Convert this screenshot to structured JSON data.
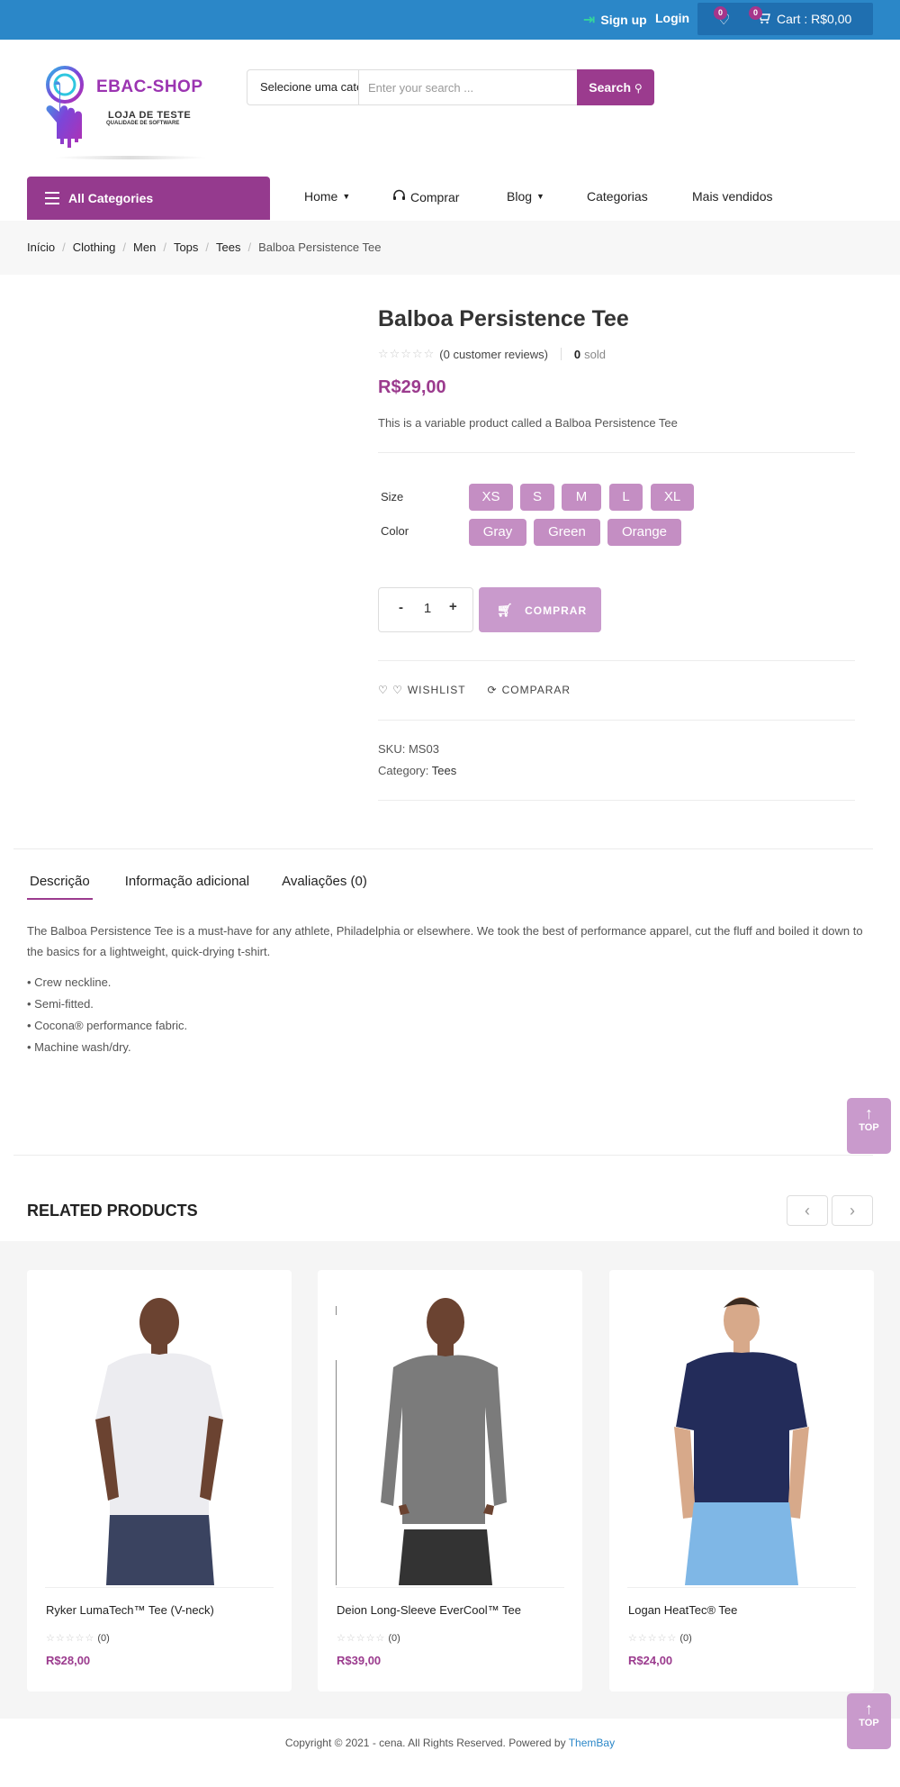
{
  "topbar": {
    "signup": "Sign up",
    "login": "Login",
    "wishlist_count": "0",
    "cart_count": "0",
    "cart_label": "Cart : R$0,00"
  },
  "header": {
    "brand": "EBAC-SHOP",
    "tagline": "LOJA DE TESTE",
    "tagline_sub": "QUALIDADE DE SOFTWARE",
    "category_select": "Selecione uma categoria",
    "search_placeholder": "Enter your search ...",
    "search_button": "Search"
  },
  "nav": {
    "all_categories": "All Categories",
    "home": "Home",
    "comprar": "Comprar",
    "blog": "Blog",
    "categorias": "Categorias",
    "mais_vendidos": "Mais vendidos"
  },
  "breadcrumb": [
    "Início",
    "Clothing",
    "Men",
    "Tops",
    "Tees",
    "Balboa Persistence Tee"
  ],
  "product": {
    "title": "Balboa Persistence Tee",
    "stars": "☆☆☆☆☆",
    "reviews": "(0 customer reviews)",
    "sold_count": "0",
    "sold_label": "sold",
    "price": "R$29,00",
    "short_desc": "This is a variable product called a Balboa Persistence Tee",
    "size_label": "Size",
    "sizes": [
      "XS",
      "S",
      "M",
      "L",
      "XL"
    ],
    "color_label": "Color",
    "colors": [
      "Gray",
      "Green",
      "Orange"
    ],
    "qty_minus": "-",
    "qty_value": "1",
    "qty_plus": "+",
    "buy_button": "COMPRAR",
    "wishlist": "WISHLIST",
    "compare": "COMPARAR",
    "sku_label": "SKU:",
    "sku": "MS03",
    "category_label": "Category:",
    "category": "Tees"
  },
  "tabs": {
    "description": "Descrição",
    "additional": "Informação adicional",
    "reviews": "Avaliações (0)"
  },
  "description": {
    "text": "The Balboa Persistence Tee is a must-have for any athlete, Philadelphia or elsewhere. We took the best of performance apparel, cut the fluff and boiled it down to the basics for a lightweight, quick-drying t-shirt.",
    "bullets": [
      "• Crew neckline.",
      "• Semi-fitted.",
      "• Cocona® performance fabric.",
      "• Machine wash/dry."
    ]
  },
  "top_button": "TOP",
  "related": {
    "title": "RELATED PRODUCTS",
    "prev": "‹",
    "next": "›",
    "products": [
      {
        "name": "Ryker LumaTech™ Tee (V-neck)",
        "stars": "☆☆☆☆☆",
        "count": "(0)",
        "price": "R$28,00"
      },
      {
        "name": "Deion Long-Sleeve EverCool™ Tee",
        "stars": "☆☆☆☆☆",
        "count": "(0)",
        "price": "R$39,00"
      },
      {
        "name": "Logan HeatTec® Tee",
        "stars": "☆☆☆☆☆",
        "count": "(0)",
        "price": "R$24,00"
      }
    ]
  },
  "footer": {
    "copyright": "Copyright © 2021 - cena. All Rights Reserved. Powered by ",
    "link": "ThemBay"
  },
  "colors": {
    "topbar": "#2b87c8",
    "accent": "#9b3b8e",
    "swatch": "#c48ec3"
  }
}
